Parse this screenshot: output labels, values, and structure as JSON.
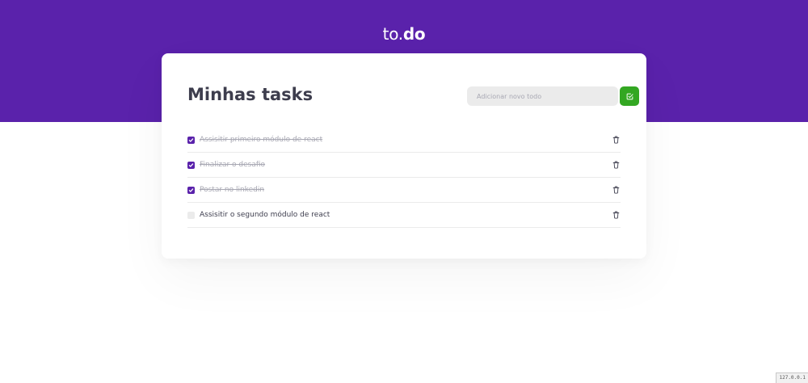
{
  "header": {
    "logo_prefix": "to.",
    "logo_bold": "do",
    "background_color": "#5a22ab"
  },
  "card": {
    "title": "Minhas tasks"
  },
  "new_task": {
    "placeholder": "Adicionar novo todo",
    "value": "",
    "button_color": "#33a722",
    "button_icon": "check-square-icon"
  },
  "tasks": [
    {
      "title": "Assisitir primeiro módulo de react",
      "completed": true
    },
    {
      "title": "Finalizar o desafio",
      "completed": true
    },
    {
      "title": "Postar no linkedin",
      "completed": true
    },
    {
      "title": "Assisitir o segundo módulo de react",
      "completed": false
    }
  ],
  "task_icons": {
    "checkbox_checked_icon": "check-icon",
    "delete_icon": "trash-icon"
  },
  "status_badge": {
    "text": "127.0.0.1"
  }
}
